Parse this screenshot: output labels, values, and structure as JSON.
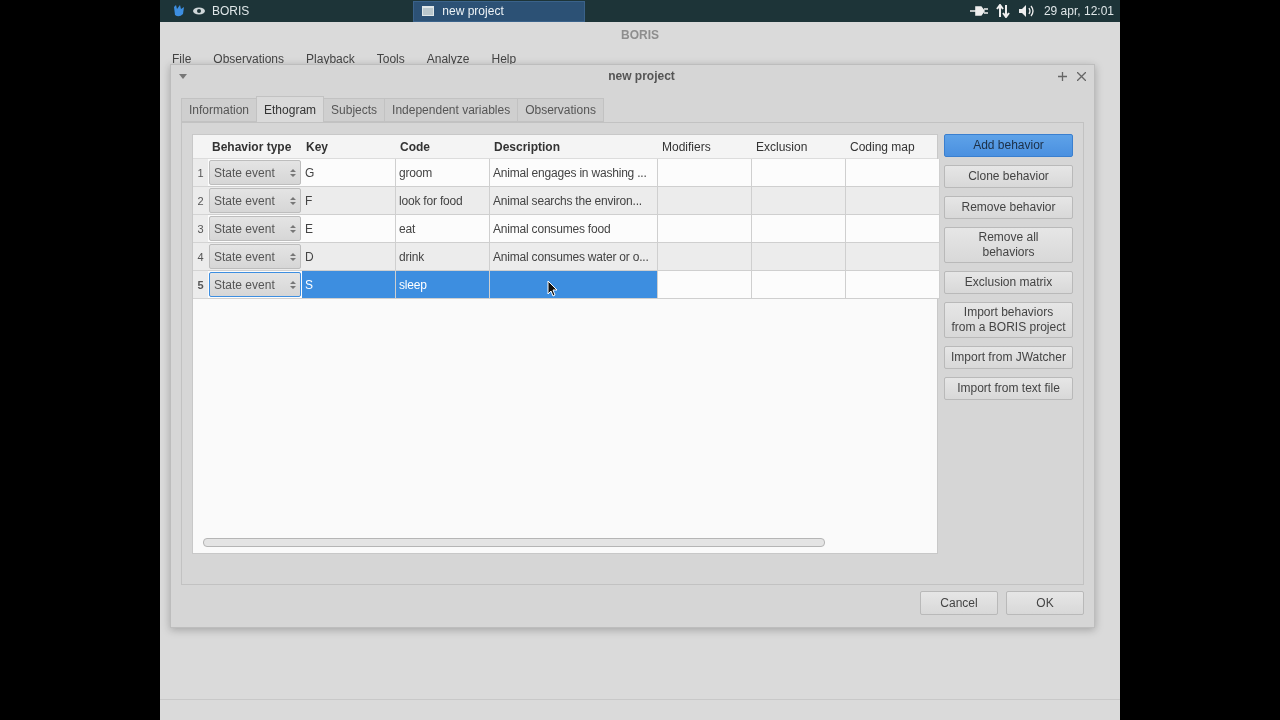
{
  "taskbar": {
    "app": "BORIS",
    "task": "new project",
    "clock": "29 apr, 12:01"
  },
  "main_window": {
    "title": "BORIS",
    "menu": [
      "File",
      "Observations",
      "Playback",
      "Tools",
      "Analyze",
      "Help"
    ]
  },
  "dialog": {
    "title": "new project",
    "tabs": [
      {
        "label": "Information",
        "selected": false
      },
      {
        "label": "Ethogram",
        "selected": true
      },
      {
        "label": "Subjects",
        "selected": false
      },
      {
        "label": "Independent variables",
        "selected": false
      },
      {
        "label": "Observations",
        "selected": false
      }
    ],
    "table": {
      "columns": [
        "Behavior type",
        "Key",
        "Code",
        "Description",
        "Modifiers",
        "Exclusion",
        "Coding map"
      ],
      "rows": [
        {
          "number": "1",
          "behavior_type": "State event",
          "key": "G",
          "code": "groom",
          "description": "Animal engages in washing ...",
          "selected": false
        },
        {
          "number": "2",
          "behavior_type": "State event",
          "key": "F",
          "code": "look for food",
          "description": "Animal searchs the environ...",
          "selected": false
        },
        {
          "number": "3",
          "behavior_type": "State event",
          "key": "E",
          "code": "eat",
          "description": "Animal consumes food",
          "selected": false
        },
        {
          "number": "4",
          "behavior_type": "State event",
          "key": "D",
          "code": "drink",
          "description": "Animal consumes water or o...",
          "selected": false
        },
        {
          "number": "5",
          "behavior_type": "State event",
          "key": "S",
          "code": "sleep",
          "description": "",
          "selected": true
        }
      ]
    },
    "side_buttons": [
      {
        "label": "Add behavior",
        "default": true
      },
      {
        "label": "Clone behavior",
        "default": false
      },
      {
        "label": "Remove behavior",
        "default": false
      },
      {
        "label": "Remove all behaviors",
        "default": false
      },
      {
        "label": "Exclusion matrix",
        "default": false
      },
      {
        "label": "Import behaviors from a BORIS project",
        "default": false
      },
      {
        "label": "Import from JWatcher",
        "default": false
      },
      {
        "label": "Import from text file",
        "default": false
      }
    ],
    "buttons": [
      "Cancel",
      "OK"
    ]
  }
}
